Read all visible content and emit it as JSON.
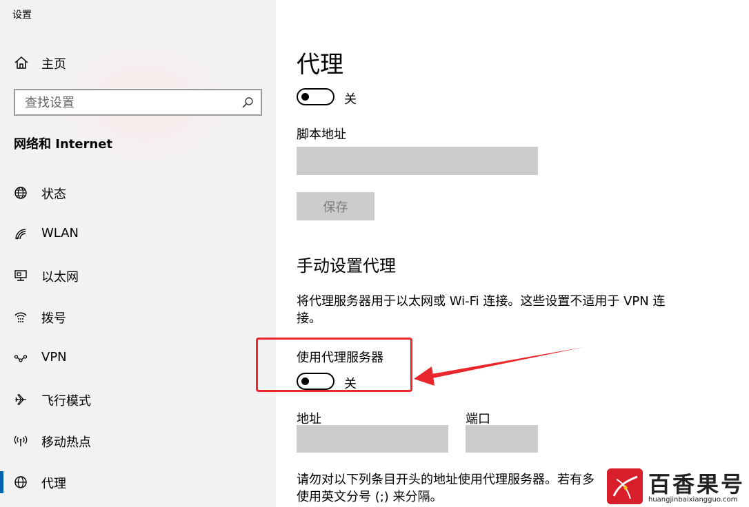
{
  "window": {
    "title": "设置"
  },
  "sidebar": {
    "home_label": "主页",
    "search": {
      "placeholder": "查找设置",
      "value": ""
    },
    "section_title": "网络和 Internet",
    "items": [
      {
        "label": "状态",
        "icon": "globe-status-icon"
      },
      {
        "label": "WLAN",
        "icon": "wifi-icon"
      },
      {
        "label": "以太网",
        "icon": "ethernet-icon"
      },
      {
        "label": "拨号",
        "icon": "dial-up-icon"
      },
      {
        "label": "VPN",
        "icon": "vpn-icon"
      },
      {
        "label": "飞行模式",
        "icon": "airplane-icon"
      },
      {
        "label": "移动热点",
        "icon": "hotspot-icon"
      },
      {
        "label": "代理",
        "icon": "globe-icon",
        "selected": true
      }
    ]
  },
  "main": {
    "title": "代理",
    "auto_proxy_toggle": {
      "state": "关",
      "on": false
    },
    "script_address_label": "脚本地址",
    "script_address_value": "",
    "save_button": "保存",
    "manual_title": "手动设置代理",
    "manual_desc_line1": "将代理服务器用于以太网或 Wi-Fi 连接。这些设置不适用于 VPN 连",
    "manual_desc_line2": "接。",
    "use_proxy_label": "使用代理服务器",
    "use_proxy_toggle": {
      "state": "关",
      "on": false
    },
    "address_label": "地址",
    "address_value": "",
    "port_label": "端口",
    "port_value": "",
    "exceptions_line1": "请勿对以下列条目开头的地址使用代理服务器。若有多",
    "exceptions_line2": "使用英文分号 (;) 来分隔。"
  },
  "annotation": {
    "highlight_color": "#e8262b"
  },
  "watermark": {
    "brand": "百香果号",
    "url": "huangjinbaixiangguo.com"
  },
  "colors": {
    "sidebar_bg": "#f2f2f2",
    "field_bg": "#cccccc",
    "accent": "#0063b1"
  }
}
